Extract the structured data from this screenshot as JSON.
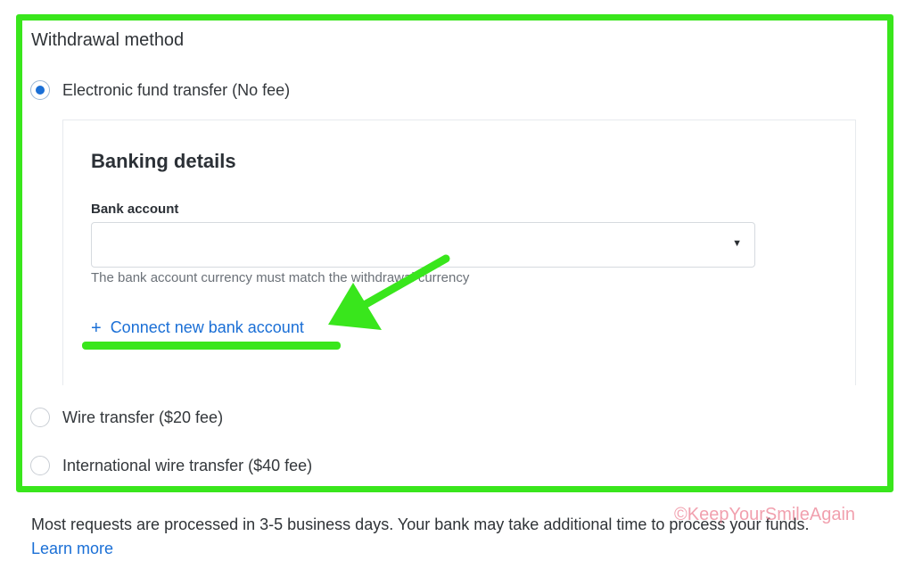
{
  "withdrawal": {
    "title": "Withdrawal method",
    "options": [
      {
        "label": "Electronic fund transfer (No fee)",
        "selected": true
      },
      {
        "label": "Wire transfer ($20 fee)",
        "selected": false
      },
      {
        "label": "International wire transfer ($40 fee)",
        "selected": false
      }
    ]
  },
  "banking": {
    "title": "Banking details",
    "bank_account_label": "Bank account",
    "bank_account_value": "",
    "hint": "The bank account currency must match the withdrawal currency",
    "connect_plus": "+",
    "connect_label": "Connect new bank account"
  },
  "footer": {
    "info": "Most requests are processed in 3-5 business days. Your bank may take additional time to process your funds.",
    "learn_more": "Learn more"
  },
  "watermark": "©KeepYourSmileAgain",
  "colors": {
    "accent": "#1a6fd6",
    "annotation": "#39e61c",
    "watermark": "#eb788c"
  },
  "icons": {
    "selected_radio": "radio-checked-icon",
    "unselected_radio": "radio-unchecked-icon",
    "dropdown": "caret-down-icon",
    "annotation_arrow": "arrow-annotation-icon"
  }
}
